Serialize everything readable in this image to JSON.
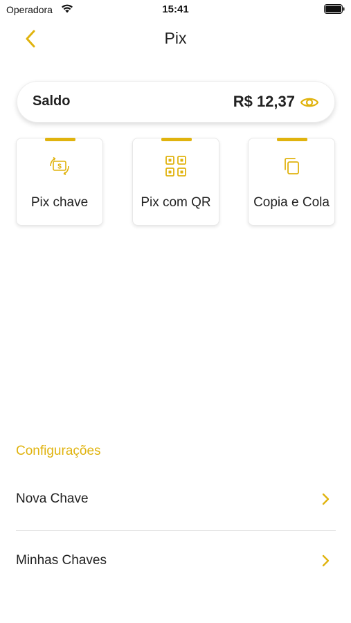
{
  "status_bar": {
    "carrier": "Operadora",
    "time": "15:41"
  },
  "nav": {
    "title": "Pix"
  },
  "balance": {
    "label": "Saldo",
    "value": "R$ 12,37"
  },
  "actions": [
    {
      "label": "Pix chave",
      "icon": "money-transfer-icon"
    },
    {
      "label": "Pix com QR",
      "icon": "qr-code-icon"
    },
    {
      "label": "Copia e Cola",
      "icon": "copy-icon"
    }
  ],
  "settings": {
    "title": "Configurações",
    "items": [
      {
        "label": "Nova Chave"
      },
      {
        "label": "Minhas Chaves"
      }
    ]
  },
  "colors": {
    "accent": "#e0b30e",
    "text": "#222222"
  }
}
